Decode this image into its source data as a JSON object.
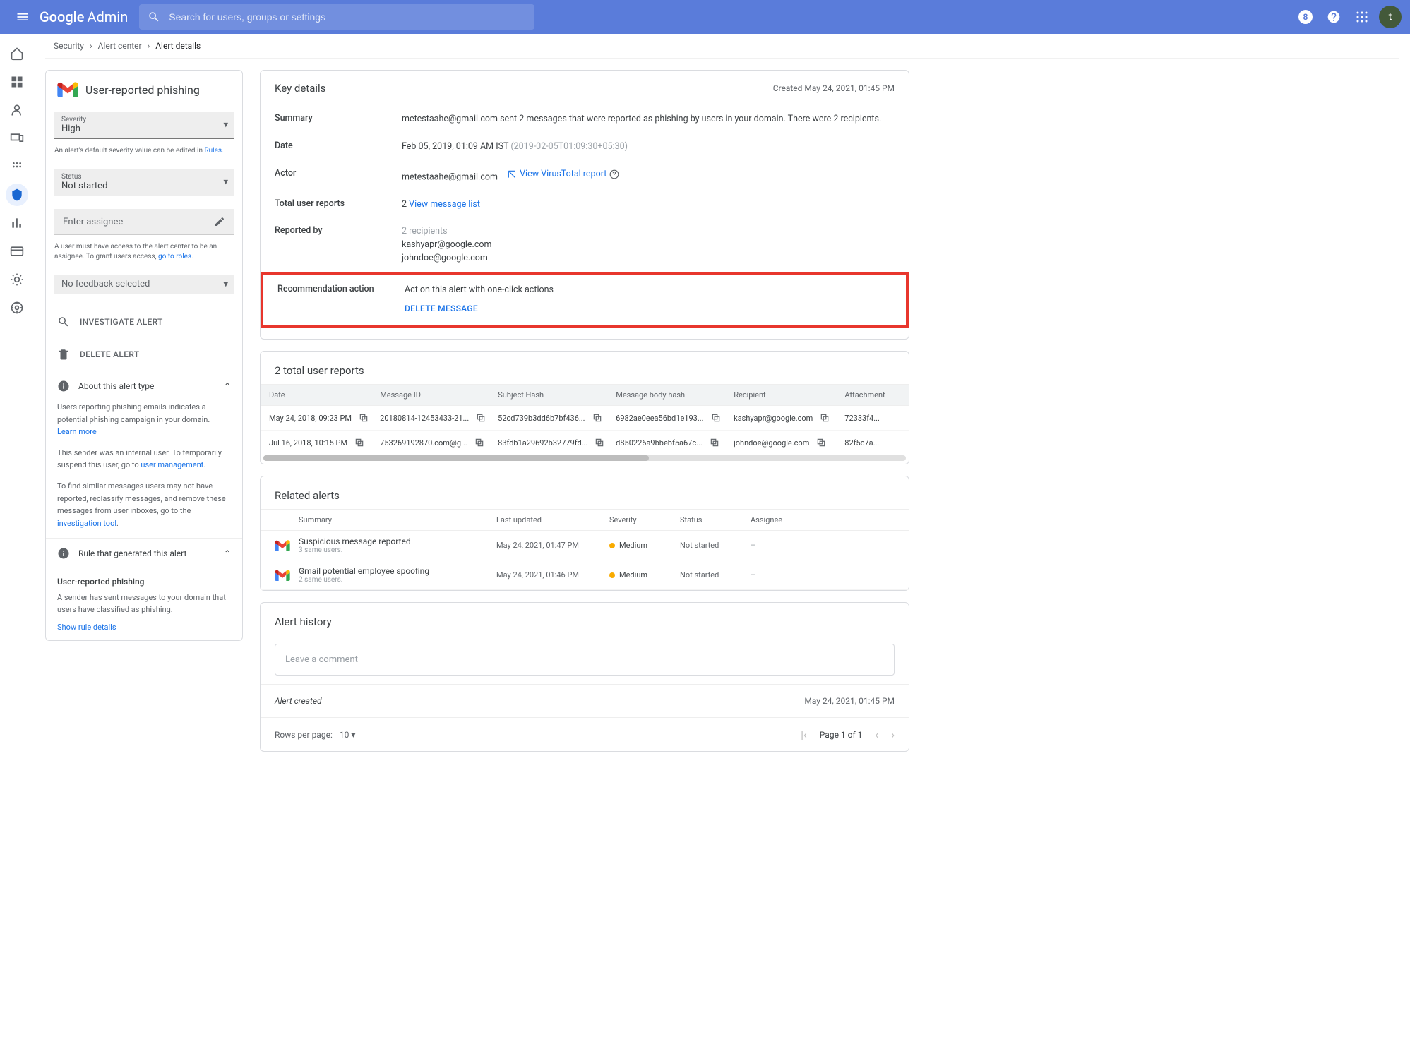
{
  "header": {
    "product_g": "Google",
    "product_a": "Admin",
    "search_placeholder": "Search for users, groups or settings",
    "avatar": "t"
  },
  "breadcrumb": {
    "l1": "Security",
    "l2": "Alert center",
    "l3": "Alert details"
  },
  "sidebar": {
    "title": "User-reported phishing",
    "severity_label": "Severity",
    "severity_value": "High",
    "severity_note_pre": "An alert's default severity value can be edited in ",
    "severity_note_link": "Rules",
    "status_label": "Status",
    "status_value": "Not started",
    "assignee_placeholder": "Enter assignee",
    "assignee_note_pre": "A user must have access to the alert center to be an assignee. To grant users access, ",
    "assignee_note_link": "go to roles",
    "feedback": "No feedback selected",
    "investigate": "INVESTIGATE ALERT",
    "delete": "DELETE ALERT",
    "about_header": "About this alert type",
    "about_p1_pre": "Users reporting phishing emails indicates a potential phishing campaign in your domain. ",
    "about_p1_link": "Learn more",
    "about_p2_pre": "This sender was an internal user. To temporarily suspend this user, go to ",
    "about_p2_link": "user management",
    "about_p3_pre": "To find similar messages users may not have reported, reclassify messages, and remove these messages from user inboxes, go to the ",
    "about_p3_link": "investigation tool",
    "rule_header": "Rule that generated this alert",
    "rule_name": "User-reported phishing",
    "rule_desc": "A sender has sent messages to your domain that users have classified as phishing.",
    "rule_link": "Show rule details"
  },
  "details": {
    "title": "Key details",
    "created": "Created May 24, 2021, 01:45 PM",
    "rows": {
      "summary_lbl": "Summary",
      "summary_val": "metestaahe@gmail.com sent 2 messages that were reported as phishing by users in your domain. There were 2 recipients.",
      "date_lbl": "Date",
      "date_val": "Feb 05, 2019, 01:09 AM IST",
      "date_iso": " (2019-02-05T01:09:30+05:30)",
      "actor_lbl": "Actor",
      "actor_val": "metestaahe@gmail.com",
      "vt_link": "View VirusTotal report",
      "reports_lbl": "Total user reports",
      "reports_count": "2",
      "reports_link": "View message list",
      "by_lbl": "Reported by",
      "by_v0": "2 recipients",
      "by_v1": "kashyapr@google.com",
      "by_v2": "johndoe@google.com",
      "rec_lbl": "Recommendation action",
      "rec_val": "Act on this alert with one-click actions",
      "rec_btn": "DELETE MESSAGE"
    }
  },
  "reports": {
    "title": "2 total user reports",
    "cols": {
      "date": "Date",
      "msg": "Message ID",
      "subj": "Subject Hash",
      "body": "Message body hash",
      "rec": "Recipient",
      "att": "Attachment"
    },
    "rows": [
      {
        "date": "May 24, 2018, 09:23 PM",
        "msg": "20180814-12453433-21...",
        "subj": "52cd739b3dd6b7bf436...",
        "body": "6982ae0eea56bd1e193...",
        "rec": "kashyapr@google.com",
        "att": "72333f4..."
      },
      {
        "date": "Jul 16, 2018, 10:15 PM",
        "msg": "753269192870.com@g...",
        "subj": "83fdb1a29692b32779fd...",
        "body": "d850226a9bbebf5a67c...",
        "rec": "johndoe@google.com",
        "att": "82f5c7a..."
      }
    ]
  },
  "related": {
    "title": "Related alerts",
    "cols": {
      "summary": "Summary",
      "upd": "Last updated",
      "sev": "Severity",
      "status": "Status",
      "assign": "Assignee"
    },
    "rows": [
      {
        "summary": "Suspicious message reported",
        "sub": "3 same users.",
        "upd": "May 24, 2021, 01:47 PM",
        "sev": "Medium",
        "status": "Not started",
        "assign": "–"
      },
      {
        "summary": "Gmail potential employee spoofing",
        "sub": "2 same users.",
        "upd": "May 24, 2021, 01:46 PM",
        "sev": "Medium",
        "status": "Not started",
        "assign": "–"
      }
    ]
  },
  "history": {
    "title": "Alert history",
    "comment_placeholder": "Leave a comment",
    "created_label": "Alert created",
    "created_date": "May 24, 2021, 01:45 PM"
  },
  "pager": {
    "rpp_label": "Rows per page:",
    "rpp_value": "10",
    "page": "Page 1 of 1"
  }
}
